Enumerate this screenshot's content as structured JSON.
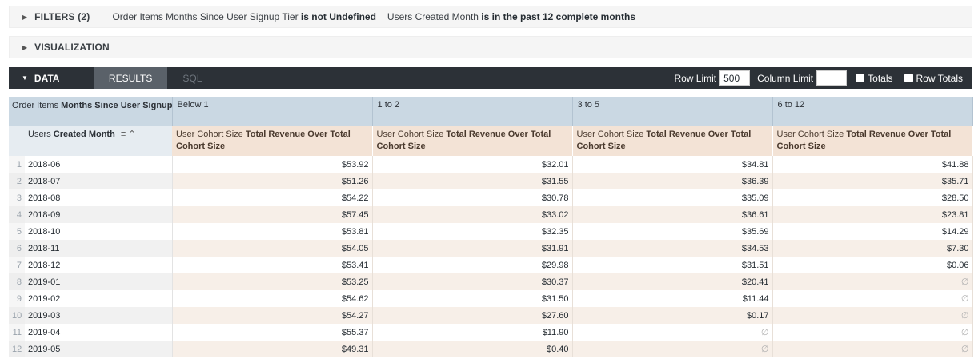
{
  "filters": {
    "title": "FILTERS (2)",
    "items": [
      {
        "field": "Order Items Months Since User Signup Tier",
        "condition": "is not Undefined"
      },
      {
        "field": "Users Created Month",
        "condition": "is in the past 12 complete months"
      }
    ]
  },
  "visualization": {
    "title": "VISUALIZATION"
  },
  "data_bar": {
    "title": "DATA",
    "tab_results": "RESULTS",
    "tab_sql": "SQL",
    "row_limit_label": "Row Limit",
    "row_limit_value": "500",
    "column_limit_label": "Column Limit",
    "column_limit_value": "",
    "totals_label": "Totals",
    "row_totals_label": "Row Totals"
  },
  "table": {
    "pivot_label_prefix": "Order Items",
    "pivot_label_bold": "Months Since User Signup Tier",
    "pivot_values": [
      "Below 1",
      "1 to 2",
      "3 to 5",
      "6 to 12"
    ],
    "dimension_prefix": "Users",
    "dimension_bold": "Created Month",
    "measure_prefix": "User Cohort Size",
    "measure_bold": "Total Revenue Over Total Cohort Size",
    "null_symbol": "∅",
    "rows": [
      {
        "num": "1",
        "month": "2018-06",
        "values": [
          "$53.92",
          "$32.01",
          "$34.81",
          "$41.88"
        ]
      },
      {
        "num": "2",
        "month": "2018-07",
        "values": [
          "$51.26",
          "$31.55",
          "$36.39",
          "$35.71"
        ]
      },
      {
        "num": "3",
        "month": "2018-08",
        "values": [
          "$54.22",
          "$30.78",
          "$35.09",
          "$28.50"
        ]
      },
      {
        "num": "4",
        "month": "2018-09",
        "values": [
          "$57.45",
          "$33.02",
          "$36.61",
          "$23.81"
        ]
      },
      {
        "num": "5",
        "month": "2018-10",
        "values": [
          "$53.81",
          "$32.35",
          "$35.69",
          "$14.29"
        ]
      },
      {
        "num": "6",
        "month": "2018-11",
        "values": [
          "$54.05",
          "$31.91",
          "$34.53",
          "$7.30"
        ]
      },
      {
        "num": "7",
        "month": "2018-12",
        "values": [
          "$53.41",
          "$29.98",
          "$31.51",
          "$0.06"
        ]
      },
      {
        "num": "8",
        "month": "2019-01",
        "values": [
          "$53.25",
          "$30.37",
          "$20.41",
          null
        ]
      },
      {
        "num": "9",
        "month": "2019-02",
        "values": [
          "$54.62",
          "$31.50",
          "$11.44",
          null
        ]
      },
      {
        "num": "10",
        "month": "2019-03",
        "values": [
          "$54.27",
          "$27.60",
          "$0.17",
          null
        ]
      },
      {
        "num": "11",
        "month": "2019-04",
        "values": [
          "$55.37",
          "$11.90",
          null,
          null
        ]
      },
      {
        "num": "12",
        "month": "2019-05",
        "values": [
          "$49.31",
          "$0.40",
          null,
          null
        ]
      }
    ]
  }
}
